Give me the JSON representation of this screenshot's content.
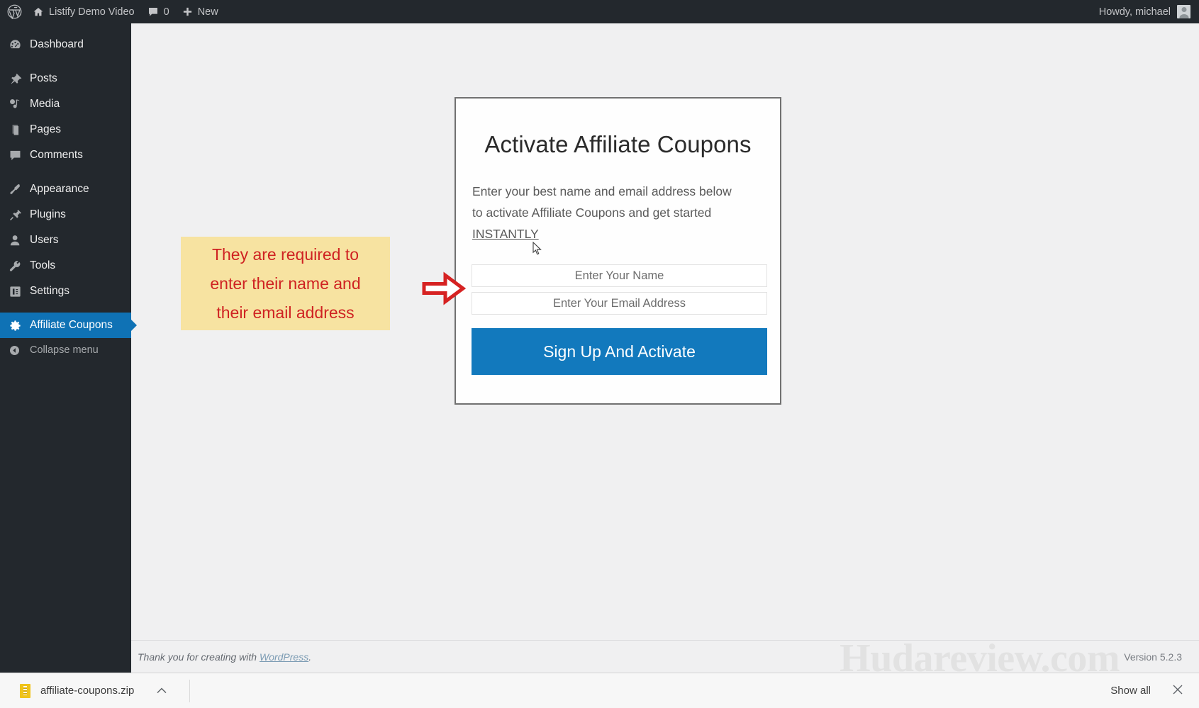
{
  "adminbar": {
    "logo_icon": "wordpress-logo-icon",
    "site_icon": "home-icon",
    "site_name": "Listify Demo Video",
    "comments_icon": "comment-bubble-icon",
    "comments_count": "0",
    "new_icon": "plus-icon",
    "new_label": "New",
    "greeting": "Howdy, michael",
    "avatar_name": "user-avatar"
  },
  "sidebar": {
    "items": [
      {
        "label": "Dashboard",
        "icon": "dashboard-icon",
        "current": false
      },
      {
        "label": "Posts",
        "icon": "pin-icon",
        "current": false
      },
      {
        "label": "Media",
        "icon": "media-icon",
        "current": false
      },
      {
        "label": "Pages",
        "icon": "pages-icon",
        "current": false
      },
      {
        "label": "Comments",
        "icon": "comment-bubble-icon",
        "current": false
      },
      {
        "label": "Appearance",
        "icon": "paintbrush-icon",
        "current": false
      },
      {
        "label": "Plugins",
        "icon": "plug-icon",
        "current": false
      },
      {
        "label": "Users",
        "icon": "user-icon",
        "current": false
      },
      {
        "label": "Tools",
        "icon": "wrench-icon",
        "current": false
      },
      {
        "label": "Settings",
        "icon": "settings-sliders-icon",
        "current": false
      },
      {
        "label": "Affiliate Coupons",
        "icon": "gear-icon",
        "current": true
      }
    ],
    "collapse_label": "Collapse menu",
    "collapse_icon": "collapse-arrow-icon",
    "current_color": "#0f72b5"
  },
  "modal": {
    "title": "Activate Affiliate Coupons",
    "desc_line1": "Enter your best name and email address below",
    "desc_line2": "to activate Affiliate Coupons and get started",
    "desc_line3": "INSTANTLY",
    "name_placeholder": "Enter Your Name",
    "name_value": "",
    "email_placeholder": "Enter Your Email Address",
    "email_value": "",
    "cta_label": "Sign Up And Activate",
    "cta_color": "#1279bd"
  },
  "annotation": {
    "line1": "They are required to",
    "line2": "enter their name and",
    "line3": "their email address",
    "box_color": "#f7e3a1",
    "text_color": "#cf2222",
    "arrow_icon": "right-arrow-icon",
    "arrow_color": "#d62222"
  },
  "footer": {
    "thanks_prefix": "Thank you for creating with ",
    "thanks_link": "WordPress",
    "thanks_suffix": ".",
    "version": "Version 5.2.3",
    "watermark": "Hudareview.com"
  },
  "downloadbar": {
    "file_name": "affiliate-coupons.zip",
    "file_icon": "zip-file-icon",
    "expand_icon": "chevron-up-icon",
    "show_all_label": "Show all",
    "close_icon": "close-icon"
  }
}
